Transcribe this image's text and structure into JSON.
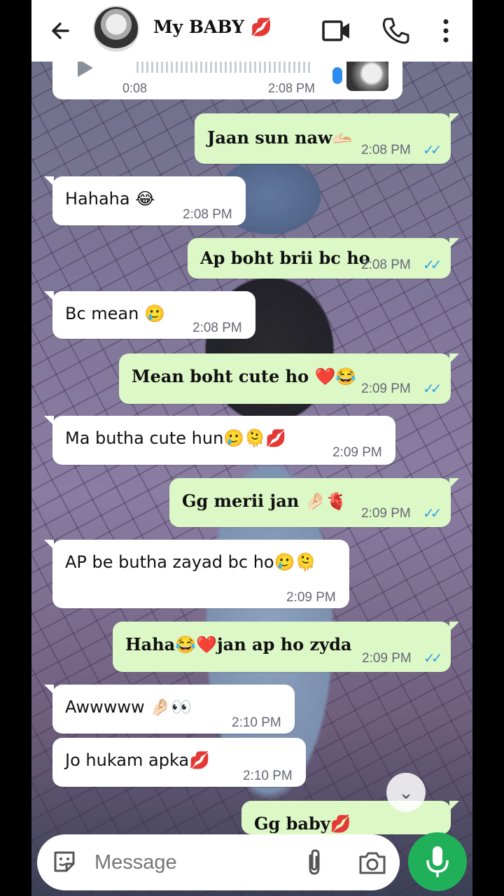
{
  "header": {
    "contact_name": "My BABY 💋",
    "icons": [
      "back-arrow-icon",
      "avatar",
      "video-call-icon",
      "phone-call-icon",
      "more-vert-icon"
    ]
  },
  "voice_message": {
    "duration": "0:08",
    "time": "2:08 PM"
  },
  "messages": [
    {
      "dir": "out",
      "text": "Jaan sun naw🫴🏻",
      "time": "2:08 PM"
    },
    {
      "dir": "in",
      "text": "Hahaha 😂",
      "time": "2:08 PM"
    },
    {
      "dir": "out",
      "text": "Ap boht brii bc ho",
      "time": "2:08 PM"
    },
    {
      "dir": "in",
      "text": "Bc mean 🥲",
      "time": "2:08 PM"
    },
    {
      "dir": "out",
      "text": "Mean boht cute ho ❤️😂",
      "time": "2:09 PM"
    },
    {
      "dir": "in",
      "text": "Ma butha cute hun🥲🫠💋",
      "time": "2:09 PM"
    },
    {
      "dir": "out",
      "text": "Gg merii jan 🤌🏻🫀",
      "time": "2:09 PM"
    },
    {
      "dir": "in",
      "text": "AP be butha zayad bc ho🥲🫠",
      "time": "2:09 PM"
    },
    {
      "dir": "out",
      "text": "Haha😂❤️jan ap ho zyda",
      "time": "2:09 PM"
    },
    {
      "dir": "in",
      "text": "Awwwww 🤌🏻👀",
      "time": "2:10 PM"
    },
    {
      "dir": "in",
      "text": "Jo hukam apka💋",
      "time": "2:10 PM"
    },
    {
      "dir": "out",
      "text": "Gg baby💋",
      "time": ""
    }
  ],
  "composer": {
    "placeholder": "Message"
  },
  "colors": {
    "outgoing": "#dcf8c6",
    "incoming": "#ffffff",
    "accent": "#21b05a",
    "read_ticks": "#34a0e8"
  }
}
